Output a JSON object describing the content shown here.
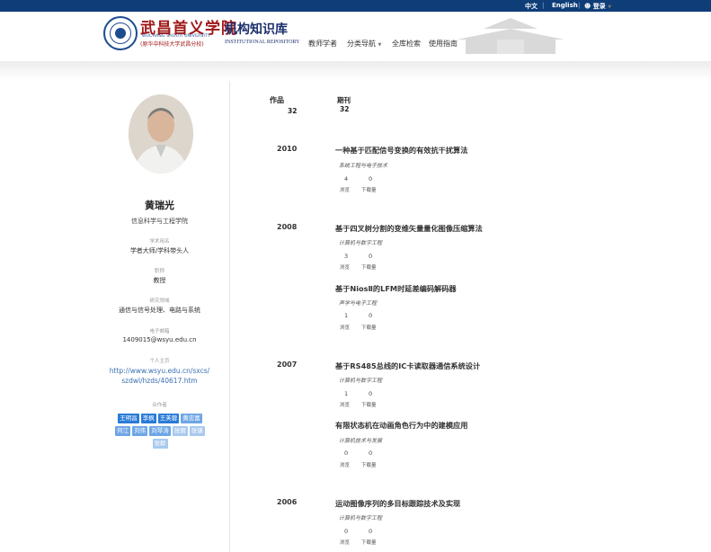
{
  "topbar": {
    "lang_zh": "中文",
    "separator": "|",
    "lang_en": "English",
    "login": "登录"
  },
  "header": {
    "school_cn": "武昌首义学院",
    "school_en": "WUCHANG SHOUYI UNIVERSITY",
    "school_sub": "(原华中科技大学武昌分校)",
    "repo_cn": "机构知识库",
    "repo_en": "INSTITUTIONAL REPOSITORY",
    "nav": [
      "教师学者",
      "分类导航",
      "全库检索",
      "使用指南"
    ]
  },
  "profile": {
    "name": "黄瑞光",
    "department": "信息科学与工程学院",
    "fields": [
      {
        "label": "学术用名",
        "value": "学者大师/学科带头人"
      },
      {
        "label": "职称",
        "value": "教授"
      },
      {
        "label": "研究领域",
        "value": "通信与信号处理、电路与系统"
      },
      {
        "label": "电子邮箱",
        "value": "1409015@wsyu.edu.cn"
      }
    ],
    "homepage_label": "个人主页",
    "homepage_line1": "http://www.wsyu.edu.cn/sxcs/",
    "homepage_line2": "szdwl/hzds/40617.htm",
    "coauthors_label": "合作者",
    "coauthors": [
      "王明昌",
      "李枫",
      "王芙蓉",
      "黄忠富",
      "何江",
      "刘伟",
      "刘琴涛",
      "张丽",
      "张谦",
      "张群"
    ]
  },
  "summary": {
    "works_label": "作品",
    "works_count": "32",
    "journal_label": "期刊",
    "journal_count": "32"
  },
  "stat_labels": {
    "views": "浏览",
    "downloads": "下载量"
  },
  "publications": [
    {
      "year": "2010",
      "title": "一种基于匹配信号变换的有效抗干扰算法",
      "journal": "系统工程与电子技术",
      "views": "4",
      "downloads": "0"
    },
    {
      "year": "2008",
      "title": "基于四叉树分割的变维矢量量化图像压缩算法",
      "journal": "计算机与数字工程",
      "views": "3",
      "downloads": "0"
    },
    {
      "year": "",
      "title": "基于NiosⅡ的LFM时延差编码解码器",
      "journal": "声学与电子工程",
      "views": "1",
      "downloads": "0"
    },
    {
      "year": "2007",
      "title": "基于RS485总线的IC卡读取器通信系统设计",
      "journal": "计算机与数字工程",
      "views": "1",
      "downloads": "0"
    },
    {
      "year": "",
      "title": "有限状态机在动画角色行为中的建模应用",
      "journal": "计算机技术与发展",
      "views": "0",
      "downloads": "0"
    },
    {
      "year": "2006",
      "title": "运动图像序列的多目标跟踪技术及实现",
      "journal": "计算机与数字工程",
      "views": "0",
      "downloads": "0"
    }
  ]
}
